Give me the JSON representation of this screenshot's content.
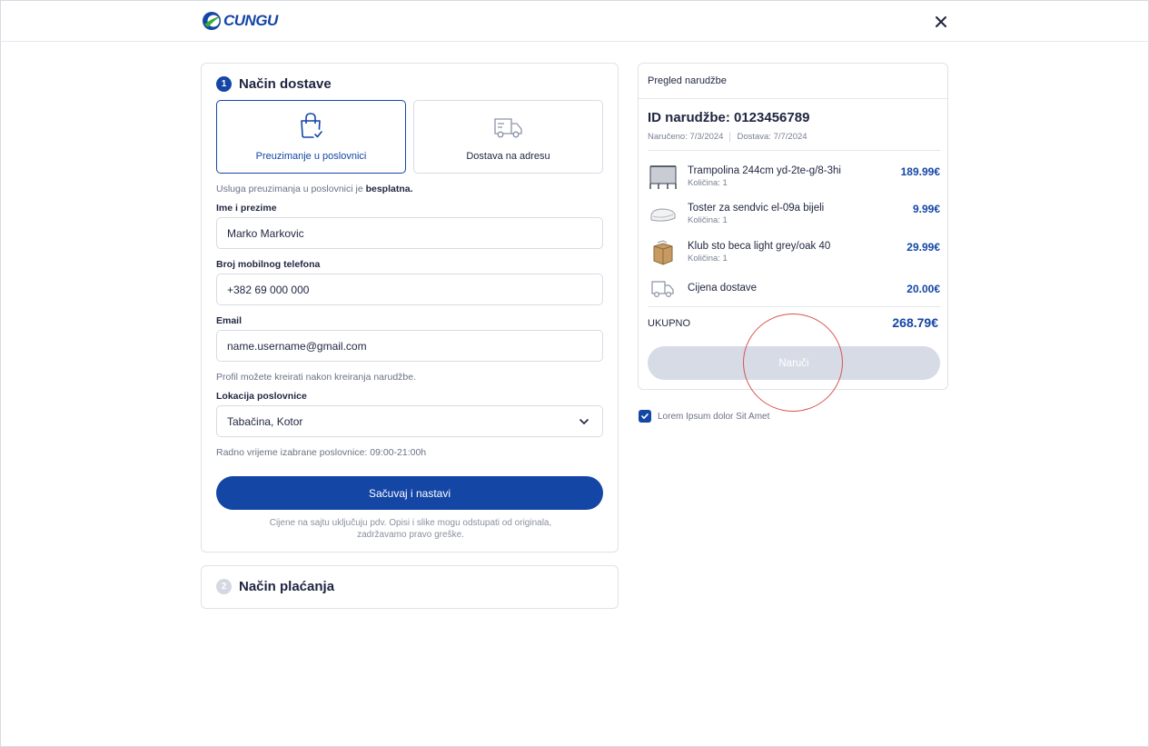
{
  "header": {
    "logo_text": "CUNGU",
    "close_icon": "close-icon"
  },
  "delivery": {
    "step_number": "1",
    "title": "Način dostave",
    "options": [
      {
        "label": "Preuzimanje u poslovnici",
        "icon": "shopping-bag-check-icon",
        "selected": true
      },
      {
        "label": "Dostava na adresu",
        "icon": "delivery-truck-icon",
        "selected": false
      }
    ],
    "note_prefix": "Usluga preuzimanja u poslovnici je ",
    "note_bold": "besplatna.",
    "name_label": "Ime i prezime",
    "name_value": "Marko Markovic",
    "phone_label": "Broj mobilnog telefona",
    "phone_value": "+382 69 000 000",
    "email_label": "Email",
    "email_value": "name.username@gmail.com",
    "profile_note": "Profil možete kreirati nakon kreiranja narudžbe.",
    "location_label": "Lokacija poslovnice",
    "location_value": "Tabačina, Kotor",
    "hours_note": "Radno vrijeme izabrane poslovnice: 09:00-21:00h",
    "save_button": "Sačuvaj i nastavi",
    "disclaimer_line1": "Cijene na sajtu uključuju pdv. Opisi i slike mogu odstupati od originala,",
    "disclaimer_line2": "zadržavamo pravo greške."
  },
  "payment": {
    "step_number": "2",
    "title": "Način plaćanja"
  },
  "summary": {
    "header_title": "Pregled narudžbe",
    "order_id": "ID narudžbe: 0123456789",
    "ordered_date": "Naručeno: 7/3/2024",
    "delivery_date": "Dostava: 7/7/2024",
    "items": [
      {
        "name": "Trampolina 244cm yd-2te-g/8-3hi",
        "qty": "Količina: 1",
        "price": "189.99€",
        "icon": "trampoline-icon"
      },
      {
        "name": "Toster za sendvic el-09a bijeli",
        "qty": "Količina: 1",
        "price": "9.99€",
        "icon": "sandwich-toaster-icon"
      },
      {
        "name": "Klub sto beca light grey/oak 40",
        "qty": "Količina: 1",
        "price": "29.99€",
        "icon": "coffee-table-icon"
      }
    ],
    "shipping_label": "Cijena dostave",
    "shipping_price": "20.00€",
    "total_label": "UKUPNO",
    "total_value": "268.79€",
    "order_button": "Naruči"
  },
  "terms": {
    "checked": true,
    "label": "Lorem Ipsum dolor Sit Amet"
  },
  "colors": {
    "brand_blue": "#1446a6",
    "disabled_button": "#d6dbe5",
    "highlight_red": "#d9534f"
  }
}
